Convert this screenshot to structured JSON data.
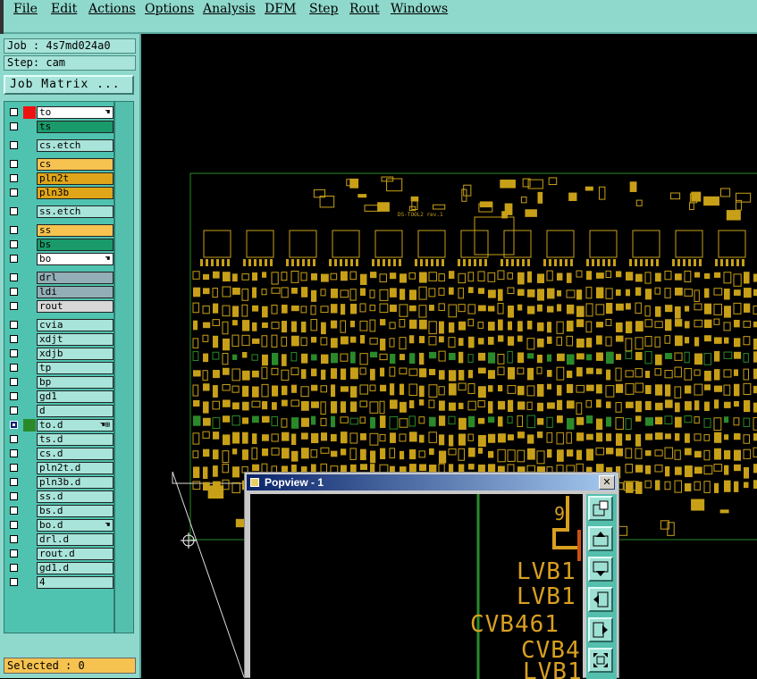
{
  "menu": {
    "items": [
      "File",
      "Edit",
      "Actions",
      "Options",
      "Analysis",
      "DFM",
      "Step",
      "Rout",
      "Windows"
    ]
  },
  "info": {
    "job": "Job : 4s7md024a0",
    "step": "Step: cam"
  },
  "job_matrix_label": "Job Matrix ...",
  "colors": {
    "panel": "#8fd8cc",
    "layer_red": "#ee1111",
    "layer_green": "#1a9a6a",
    "layer_yellow": "#f7c350",
    "layer_orange": "#e0a518",
    "layer_gray": "#93aeb6",
    "layer_white": "#ffffff",
    "layer_teal": "#a8e4da",
    "board_copper": "#c8a018",
    "board_green": "#2a8a2a"
  },
  "layers": [
    {
      "name": "to",
      "color": "#ffffff",
      "swatch": "#ee1111",
      "icon": "hand-icon",
      "gap": 0
    },
    {
      "name": "ts",
      "color": "#1a9a6a",
      "swatch": "",
      "icon": "",
      "gap": 0
    },
    {
      "name": "cs.etch",
      "color": "#a8e4da",
      "swatch": "",
      "icon": "",
      "gap": 1
    },
    {
      "name": "cs",
      "color": "#f7c350",
      "swatch": "",
      "icon": "",
      "gap": 1
    },
    {
      "name": "pln2t",
      "color": "#e0a518",
      "swatch": "",
      "icon": "",
      "gap": 0
    },
    {
      "name": "pln3b",
      "color": "#e0a518",
      "swatch": "",
      "icon": "",
      "gap": 0
    },
    {
      "name": "ss.etch",
      "color": "#a8e4da",
      "swatch": "",
      "icon": "",
      "gap": 1
    },
    {
      "name": "ss",
      "color": "#f7c350",
      "swatch": "",
      "icon": "",
      "gap": 1
    },
    {
      "name": "bs",
      "color": "#1a9a6a",
      "swatch": "",
      "icon": "",
      "gap": 0
    },
    {
      "name": "bo",
      "color": "#ffffff",
      "swatch": "",
      "icon": "hand-icon",
      "gap": 0
    },
    {
      "name": "drl",
      "color": "#93aeb6",
      "swatch": "",
      "icon": "",
      "gap": 1
    },
    {
      "name": "ldi",
      "color": "#93aeb6",
      "swatch": "",
      "icon": "",
      "gap": 0
    },
    {
      "name": "rout",
      "color": "#d8d8d8",
      "swatch": "",
      "icon": "",
      "gap": 0
    },
    {
      "name": "cvia",
      "color": "#a8e4da",
      "swatch": "",
      "icon": "",
      "gap": 1
    },
    {
      "name": "xdjt",
      "color": "#a8e4da",
      "swatch": "",
      "icon": "",
      "gap": 0
    },
    {
      "name": "xdjb",
      "color": "#a8e4da",
      "swatch": "",
      "icon": "",
      "gap": 0
    },
    {
      "name": "tp",
      "color": "#a8e4da",
      "swatch": "",
      "icon": "",
      "gap": 0
    },
    {
      "name": "bp",
      "color": "#a8e4da",
      "swatch": "",
      "icon": "",
      "gap": 0
    },
    {
      "name": "gd1",
      "color": "#a8e4da",
      "swatch": "",
      "icon": "",
      "gap": 0
    },
    {
      "name": "d",
      "color": "#a8e4da",
      "swatch": "",
      "icon": "",
      "gap": 0
    },
    {
      "name": "to.d",
      "color": "#a8e4da",
      "swatch": "#2a8a2a",
      "icon": "hand-grid-icon",
      "gap": 0,
      "active": true
    },
    {
      "name": "ts.d",
      "color": "#a8e4da",
      "swatch": "",
      "icon": "",
      "gap": 0
    },
    {
      "name": "cs.d",
      "color": "#a8e4da",
      "swatch": "",
      "icon": "",
      "gap": 0
    },
    {
      "name": "pln2t.d",
      "color": "#a8e4da",
      "swatch": "",
      "icon": "",
      "gap": 0
    },
    {
      "name": "pln3b.d",
      "color": "#a8e4da",
      "swatch": "",
      "icon": "",
      "gap": 0
    },
    {
      "name": "ss.d",
      "color": "#a8e4da",
      "swatch": "",
      "icon": "",
      "gap": 0
    },
    {
      "name": "bs.d",
      "color": "#a8e4da",
      "swatch": "",
      "icon": "",
      "gap": 0
    },
    {
      "name": "bo.d",
      "color": "#a8e4da",
      "swatch": "",
      "icon": "hand-icon",
      "gap": 0
    },
    {
      "name": "drl.d",
      "color": "#a8e4da",
      "swatch": "",
      "icon": "",
      "gap": 0
    },
    {
      "name": "rout.d",
      "color": "#a8e4da",
      "swatch": "",
      "icon": "",
      "gap": 0
    },
    {
      "name": "gd1.d",
      "color": "#a8e4da",
      "swatch": "",
      "icon": "",
      "gap": 0
    },
    {
      "name": "4",
      "color": "#a8e4da",
      "swatch": "",
      "icon": "",
      "gap": 0
    }
  ],
  "selected_label": "Selected : 0",
  "board": {
    "silk_text": "DS-TOOL2 rev.1"
  },
  "popview": {
    "title": "Popview - 1",
    "close_glyph": "✕",
    "labels": [
      "9",
      "LVB1",
      "LVB1",
      "CVB461",
      "CVB4",
      "LVB1"
    ],
    "tools": [
      "zoom-fit-icon",
      "pan-up-icon",
      "pan-down-icon",
      "pan-left-icon",
      "pan-right-icon",
      "zoom-out-icon"
    ]
  }
}
